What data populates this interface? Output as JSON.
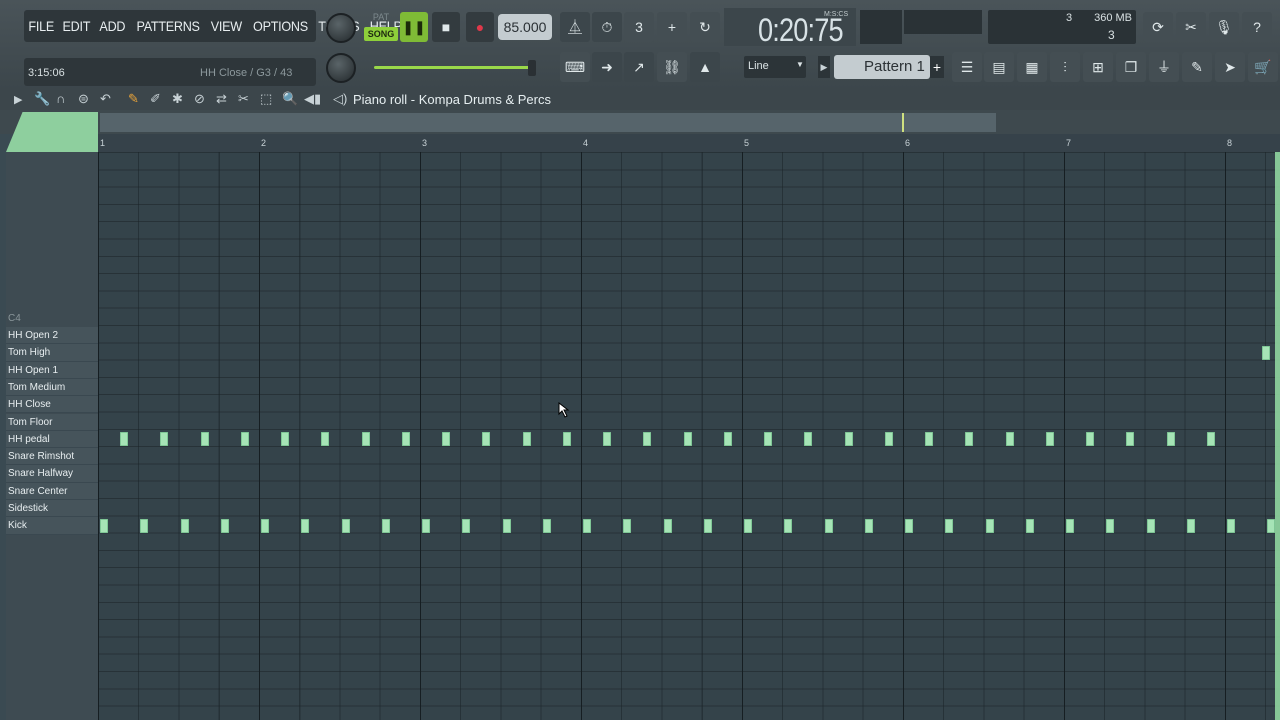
{
  "menu": [
    "FILE",
    "EDIT",
    "ADD",
    "PATTERNS",
    "VIEW",
    "OPTIONS",
    "TOOLS",
    "HELP"
  ],
  "hint": {
    "time": "3:15:06",
    "text": "HH Close / G3 / 43"
  },
  "transport": {
    "pat_label": "PAT",
    "song_label": "SONG",
    "tempo": "85.000",
    "clock": "0:20",
    "clock_cs": "75",
    "clock_unit": "M:S:CS"
  },
  "system": {
    "cpu": "3",
    "memory": "360 MB",
    "polyphony": "3"
  },
  "snap": "Line",
  "pattern": "Pattern 1",
  "piano_roll": {
    "title": "Piano roll - Kompa Drums & Percs",
    "bars": [
      "1",
      "2",
      "3",
      "4",
      "5",
      "6",
      "7",
      "8"
    ],
    "octave_label": "C4",
    "keys": [
      "HH Open 2",
      "Tom High",
      "HH Open 1",
      "Tom Medium",
      "HH Close",
      "Tom Floor",
      "HH pedal",
      "Snare Rimshot",
      "Snare Halfway",
      "Snare Center",
      "Sidestick",
      "Kick"
    ]
  },
  "notes": {
    "HH pedal_bar_positions": [
      1.125,
      1.375,
      1.625,
      1.875,
      2.125,
      2.375,
      2.625,
      2.875,
      3.125,
      3.375,
      3.625,
      3.875,
      4.125,
      4.375,
      4.625,
      4.875,
      5.125,
      5.375,
      5.625,
      5.875,
      6.125,
      6.375,
      6.625,
      6.875,
      7.125,
      7.375,
      7.625,
      7.875
    ],
    "Kick_bar_positions": [
      1.0,
      1.25,
      1.5,
      1.75,
      2.0,
      2.25,
      2.5,
      2.75,
      3.0,
      3.25,
      3.5,
      3.75,
      4.0,
      4.25,
      4.5,
      4.75,
      5.0,
      5.25,
      5.5,
      5.75,
      6.0,
      6.25,
      6.5,
      6.75,
      7.0,
      7.25,
      7.5,
      7.75,
      8.0,
      8.25
    ],
    "Tom High_bar_positions": [
      8.22
    ]
  }
}
